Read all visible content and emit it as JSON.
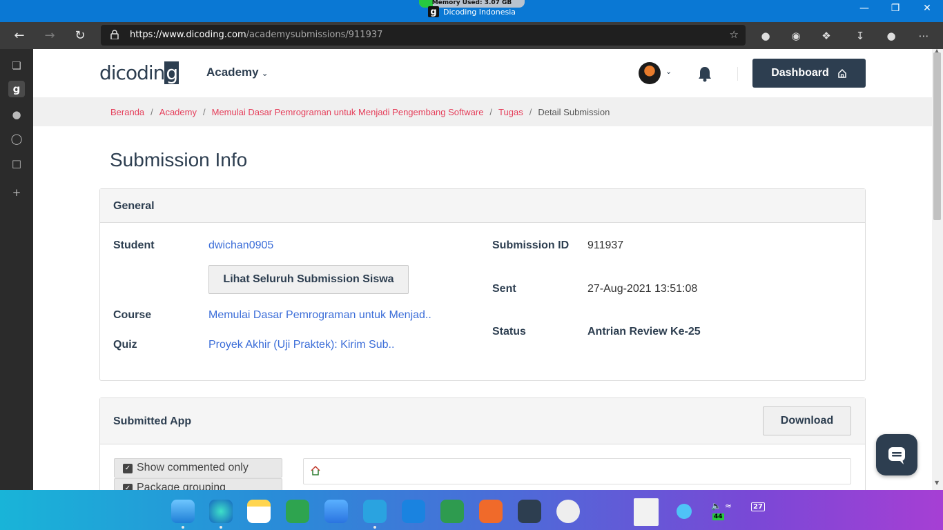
{
  "window": {
    "memory_label": "Memory Used: 3.07 GB",
    "memory_fraction": 0.13,
    "title": "Dicoding Indonesia",
    "logo_letter": "g"
  },
  "browser": {
    "url_host": "https://www.dicoding.com",
    "url_path": "/academysubmissions/911937",
    "icons": [
      "back-icon",
      "forward-icon",
      "refresh-icon",
      "lock-icon",
      "favorites-add-icon",
      "extension-icon",
      "downloads-icon",
      "more-icon"
    ]
  },
  "sidebar": {
    "items": [
      "tab-actions-icon",
      "dicoding-tab-icon",
      "drop-icon",
      "github-icon",
      "document-icon",
      "add-icon"
    ]
  },
  "header": {
    "logo_text": "dicodin",
    "logo_g": "g",
    "nav_label": "Academy",
    "dashboard_label": "Dashboard"
  },
  "breadcrumb": {
    "items": [
      "Beranda",
      "Academy",
      "Memulai Dasar Pemrograman untuk Menjadi Pengembang Software",
      "Tugas"
    ],
    "current": "Detail Submission"
  },
  "page": {
    "title": "Submission Info"
  },
  "general": {
    "heading": "General",
    "student_label": "Student",
    "student_value": "dwichan0905",
    "view_all_button": "Lihat Seluruh Submission Siswa",
    "course_label": "Course",
    "course_value": "Memulai Dasar Pemrograman untuk Menjad..",
    "quiz_label": "Quiz",
    "quiz_value": "Proyek Akhir (Uji Praktek): Kirim Sub..",
    "submission_id_label": "Submission ID",
    "submission_id_value": "911937",
    "sent_label": "Sent",
    "sent_value": "27-Aug-2021 13:51:08",
    "status_label": "Status",
    "status_value": "Antrian Review Ke-25"
  },
  "submitted_app": {
    "heading": "Submitted App",
    "download_label": "Download",
    "show_commented_label": "Show commented only",
    "package_grouping_label": "Package grouping"
  },
  "taskbar": {
    "apps": [
      "finder-icon",
      "edge-icon",
      "notes-icon",
      "facetime-icon",
      "mail-icon",
      "telegram-icon",
      "onedrive-icon",
      "android-studio-icon",
      "pen-icon",
      "drive-icon",
      "clock-icon",
      "word-icon",
      "safari-icon"
    ],
    "battery_value": "44",
    "date_value": "27"
  }
}
